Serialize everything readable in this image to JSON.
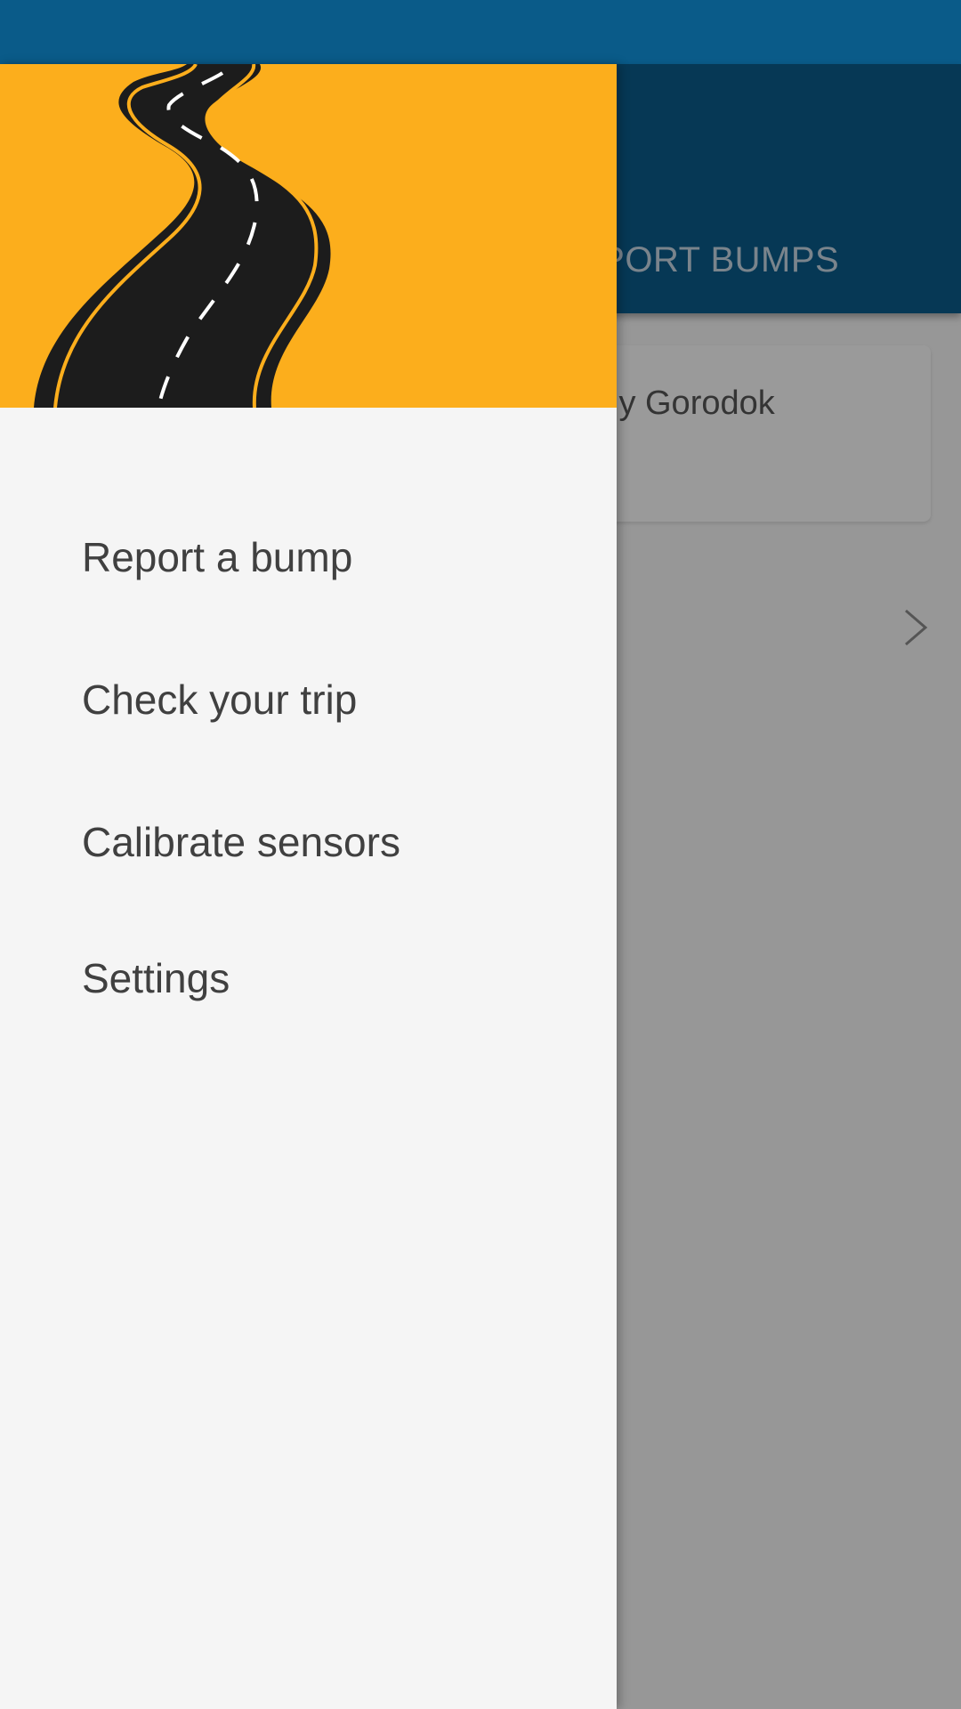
{
  "background_app": {
    "tab_label": "EPORT BUMPS",
    "card_title": "kiy Gorodok"
  },
  "drawer": {
    "header_image": "winding-road-illustration",
    "menu_items": [
      {
        "label": "Report a bump"
      },
      {
        "label": "Check your trip"
      },
      {
        "label": "Calibrate sensors"
      },
      {
        "label": "Settings"
      }
    ]
  },
  "colors": {
    "status_bar": "#0a5b89",
    "header_accent": "#fcae1c",
    "drawer_background": "#f5f5f5",
    "menu_text": "#404040"
  }
}
